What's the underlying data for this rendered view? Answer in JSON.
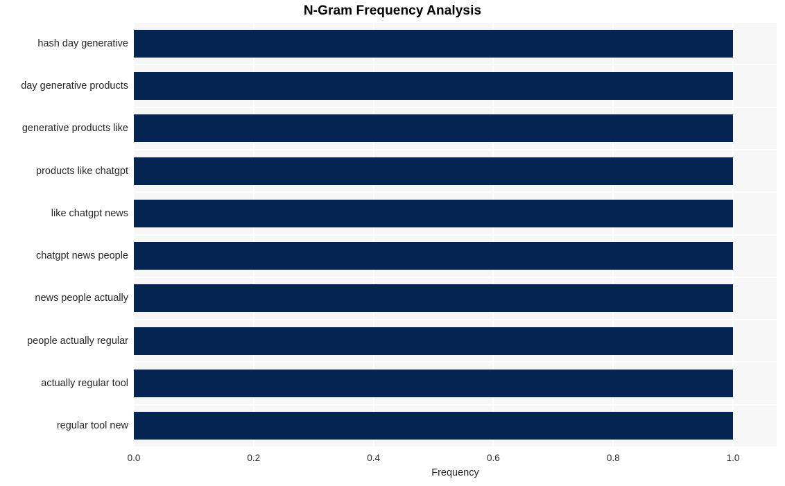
{
  "chart_data": {
    "type": "bar",
    "orientation": "horizontal",
    "title": "N-Gram Frequency Analysis",
    "xlabel": "Frequency",
    "ylabel": "",
    "categories": [
      "hash day generative",
      "day generative products",
      "generative products like",
      "products like chatgpt",
      "like chatgpt news",
      "chatgpt news people",
      "news people actually",
      "people actually regular",
      "actually regular tool",
      "regular tool new"
    ],
    "values": [
      1.0,
      1.0,
      1.0,
      1.0,
      1.0,
      1.0,
      1.0,
      1.0,
      1.0,
      1.0
    ],
    "xlim": [
      0.0,
      1.0729
    ],
    "xticks": [
      0.0,
      0.2,
      0.4,
      0.6,
      0.8,
      1.0
    ],
    "xtick_labels": [
      "0.0",
      "0.2",
      "0.4",
      "0.6",
      "0.8",
      "1.0"
    ],
    "grid": true,
    "legend": null,
    "colors": {
      "bar": "#042552",
      "plot_background": "#f7f7f7",
      "gridline": "#ffffff",
      "figure_background": "#ffffff",
      "text": "#262626",
      "title": "#000000"
    }
  }
}
